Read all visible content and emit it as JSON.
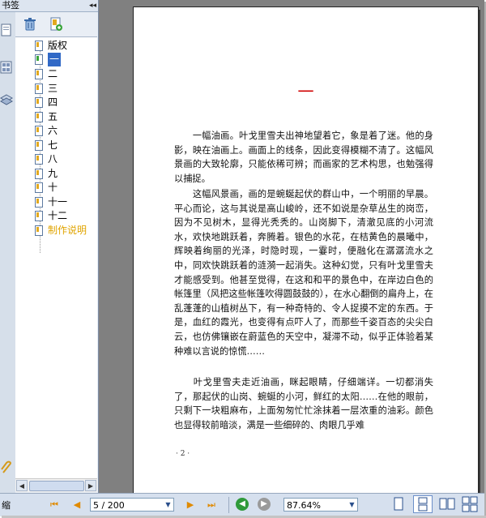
{
  "bookmark_panel": {
    "title": "书签",
    "collapse_glyph": "◂◂",
    "toolbar": [
      {
        "icon": "delete-bookmark-icon"
      },
      {
        "icon": "new-bookmark-icon"
      }
    ],
    "items": [
      {
        "label": "版权",
        "selected": false,
        "special": false
      },
      {
        "label": "一",
        "selected": true,
        "special": false
      },
      {
        "label": "二",
        "selected": false,
        "special": false
      },
      {
        "label": "三",
        "selected": false,
        "special": false
      },
      {
        "label": "四",
        "selected": false,
        "special": false
      },
      {
        "label": "五",
        "selected": false,
        "special": false
      },
      {
        "label": "六",
        "selected": false,
        "special": false
      },
      {
        "label": "七",
        "selected": false,
        "special": false
      },
      {
        "label": "八",
        "selected": false,
        "special": false
      },
      {
        "label": "九",
        "selected": false,
        "special": false
      },
      {
        "label": "十",
        "selected": false,
        "special": false
      },
      {
        "label": "十一",
        "selected": false,
        "special": false
      },
      {
        "label": "十二",
        "selected": false,
        "special": false
      },
      {
        "label": "制作说明",
        "selected": false,
        "special": true
      }
    ]
  },
  "document": {
    "chapter_title": "一",
    "paragraphs": [
      "　　一幅油画。叶戈里雪夫出神地望着它，象是着了迷。他的身影，映在油画上。画面上的线条，因此变得模糊不清了。这幅风景画的大致轮廓，只能依稀可辨；而画家的艺术构思，也勉强得以捕捉。",
      "　　这幅风景画，画的是蜿蜒起伏的群山中，一个明丽的早晨。平心而论，这与其说是高山峻岭，还不如说是杂草丛生的岗峦，因为不见树木，显得光秃秃的。山岗脚下，清澈见底的小河流水，欢快地跳跃着，奔腾着。银色的水花，在桔黄色的晨曦中，辉映着绚丽的光泽，时隐时现，一霎时，便融化在潺潺流水之中，同欢快跳跃着的涟漪一起消失。这种幻觉，只有叶戈里雪夫才能感受到。他甚至觉得，在这和和平的景色中，在岸边白色的帐篷里（风把这些帐篷吹得圆鼓鼓的），在水心翻倒的扁舟上，在乱蓬蓬的山植树丛下，有一种奇特的、令人捉摸不定的东西。于是，血红的霞光，也变得有点吓人了，而那些千姿百态的尖尖白云，也仿佛镶嵌在蔚蓝色的天空中，凝滞不动，似乎正体验着某种难以言说的惊慌……",
      "　　叶戈里雪夫走近油画，眯起眼睛，仔细端详。一切都消失了，那起伏的山岗、蜿蜒的小河，鲜红的太阳……在他的眼前，只剩下一块粗麻布，上面匆匆忙忙涂抹着一层浓重的油彩。颜色也显得较前暗淡，满是一些细碎的、肉眼几乎难"
    ],
    "page_number": "· 2 ·"
  },
  "statusbar": {
    "left_label": "缩",
    "page_field": "5 / 200",
    "zoom_field": "87.64%",
    "colors": {
      "nav_arrow": "#e08a00",
      "back_green": "#2f9a3a",
      "forward_gray": "#9a9a9a"
    }
  }
}
